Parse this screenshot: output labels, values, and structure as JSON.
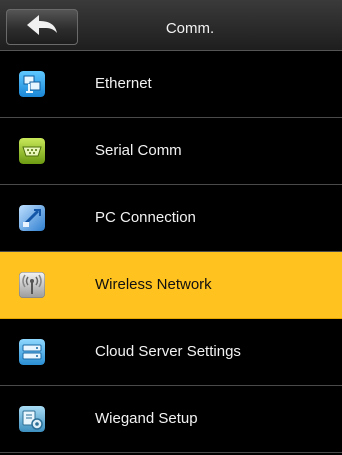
{
  "header": {
    "title": "Comm.",
    "back_icon": "back-arrow-icon"
  },
  "menu": {
    "items": [
      {
        "label": "Ethernet",
        "icon": "ethernet-icon",
        "selected": false
      },
      {
        "label": "Serial Comm",
        "icon": "serial-port-icon",
        "selected": false
      },
      {
        "label": "PC Connection",
        "icon": "pc-connection-icon",
        "selected": false
      },
      {
        "label": "Wireless Network",
        "icon": "wireless-network-icon",
        "selected": true
      },
      {
        "label": "Cloud Server Settings",
        "icon": "cloud-server-icon",
        "selected": false
      },
      {
        "label": "Wiegand Setup",
        "icon": "wiegand-icon",
        "selected": false
      }
    ]
  },
  "colors": {
    "selected_background": "#ffc21e",
    "background": "#000000",
    "text": "#f2f2f2"
  }
}
